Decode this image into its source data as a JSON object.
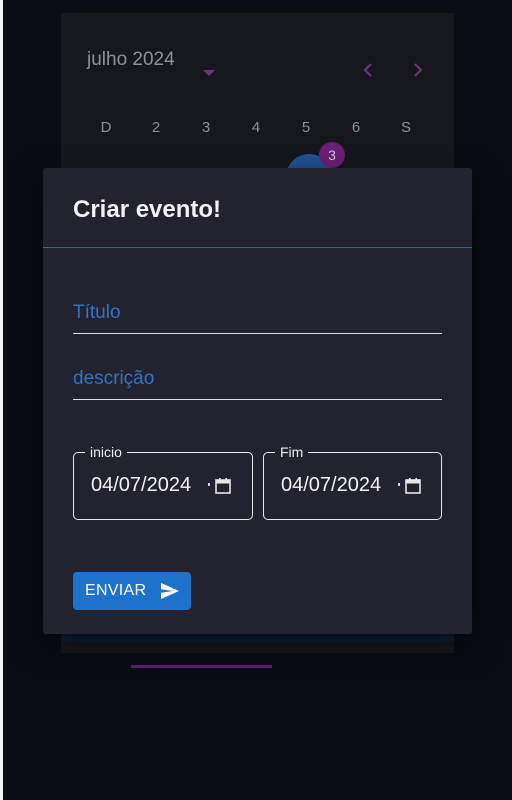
{
  "calendar": {
    "month_label": "julho 2024",
    "weekdays": [
      "D",
      "2",
      "3",
      "4",
      "5",
      "6",
      "S"
    ],
    "badge_count": "3",
    "accent_color": "#6f2f82"
  },
  "dialog": {
    "title": "Criar evento!",
    "title_placeholder": "Título",
    "description_placeholder": "descrição",
    "start": {
      "label": "inicio",
      "value": "04/07/2024"
    },
    "end": {
      "label": "Fim",
      "value": "04/07/2024"
    },
    "submit_label": "ENVIAR",
    "primary_color": "#1f72cc"
  },
  "icons": {
    "month_dropdown": "caret-down-icon",
    "previous": "chevron-left-icon",
    "next": "chevron-right-icon",
    "date_picker": "calendar-icon",
    "send": "send-icon"
  }
}
